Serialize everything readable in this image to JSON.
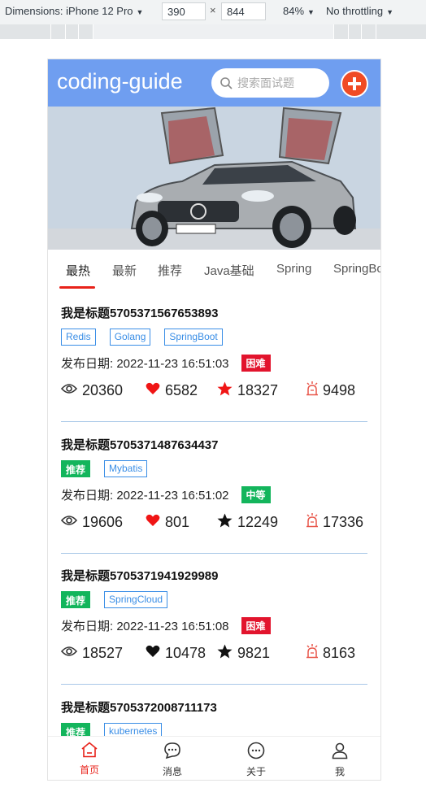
{
  "devtools": {
    "dimensions_label": "Dimensions: iPhone 12 Pro",
    "width": "390",
    "height": "844",
    "zoom": "84%",
    "throttling": "No throttling"
  },
  "header": {
    "brand": "coding-guide",
    "search_placeholder": "搜索面试题"
  },
  "tabs": [
    "最热",
    "最新",
    "推荐",
    "Java基础",
    "Spring",
    "SpringBoot"
  ],
  "posts": [
    {
      "title": "我是标题5705371567653893",
      "tags": [
        {
          "label": "Redis",
          "style": "outline"
        },
        {
          "label": "Golang",
          "style": "outline"
        },
        {
          "label": "SpringBoot",
          "style": "outline"
        }
      ],
      "date_label": "发布日期: 2022-11-23 16:51:03",
      "difficulty": "困难",
      "views": "20360",
      "likes": "6582",
      "stars": "18327",
      "alerts": "9498",
      "liked": true,
      "starred": true
    },
    {
      "title": "我是标题5705371487634437",
      "tags": [
        {
          "label": "推荐",
          "style": "solid"
        },
        {
          "label": "Mybatis",
          "style": "outline"
        }
      ],
      "date_label": "发布日期: 2022-11-23 16:51:02",
      "difficulty": "中等",
      "views": "19606",
      "likes": "801",
      "stars": "12249",
      "alerts": "17336",
      "liked": true,
      "starred": false
    },
    {
      "title": "我是标题5705371941929989",
      "tags": [
        {
          "label": "推荐",
          "style": "solid"
        },
        {
          "label": "SpringCloud",
          "style": "outline"
        }
      ],
      "date_label": "发布日期: 2022-11-23 16:51:08",
      "difficulty": "困难",
      "views": "18527",
      "likes": "10478",
      "stars": "9821",
      "alerts": "8163",
      "liked": false,
      "starred": false
    },
    {
      "title": "我是标题5705372008711173",
      "tags": [
        {
          "label": "推荐",
          "style": "solid"
        },
        {
          "label": "kubernetes",
          "style": "outline"
        }
      ],
      "date_label": "",
      "difficulty": "",
      "views": "",
      "likes": "",
      "stars": "",
      "alerts": "",
      "liked": false,
      "starred": false
    }
  ],
  "bottom_nav": [
    {
      "label": "首页",
      "icon": "home-icon",
      "active": true
    },
    {
      "label": "消息",
      "icon": "message-icon",
      "active": false
    },
    {
      "label": "关于",
      "icon": "about-icon",
      "active": false
    },
    {
      "label": "我",
      "icon": "user-icon",
      "active": false
    }
  ],
  "colors": {
    "header": "#6f9ef0",
    "accent_red": "#e8221a",
    "tag_blue": "#3a8ee6",
    "green": "#13b55c",
    "hard_red": "#e2142d"
  }
}
